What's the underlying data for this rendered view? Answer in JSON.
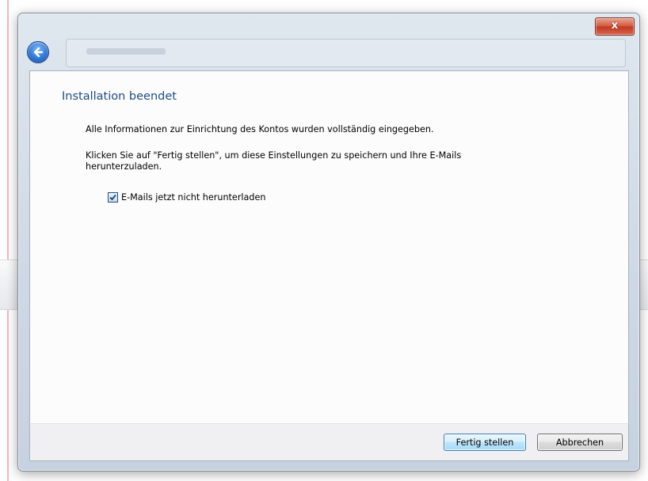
{
  "window": {
    "close_label": "x"
  },
  "page": {
    "heading": "Installation beendet",
    "paragraph1": "Alle Informationen zur Einrichtung des Kontos wurden vollständig eingegeben.",
    "paragraph2": "Klicken Sie auf \"Fertig stellen\", um diese Einstellungen zu speichern und Ihre E-Mails herunterzuladen.",
    "checkbox": {
      "label": "E-Mails jetzt nicht herunterladen",
      "checked": true
    }
  },
  "footer": {
    "finish_label": "Fertig stellen",
    "cancel_label": "Abbrechen"
  },
  "icons": {
    "back": "back-arrow-icon",
    "close": "close-icon",
    "check": "checkmark-icon"
  },
  "colors": {
    "heading": "#1f4d86",
    "close_button": "#c03a22",
    "back_button": "#2f78d8",
    "primary_button_border": "#3c7fb1"
  }
}
